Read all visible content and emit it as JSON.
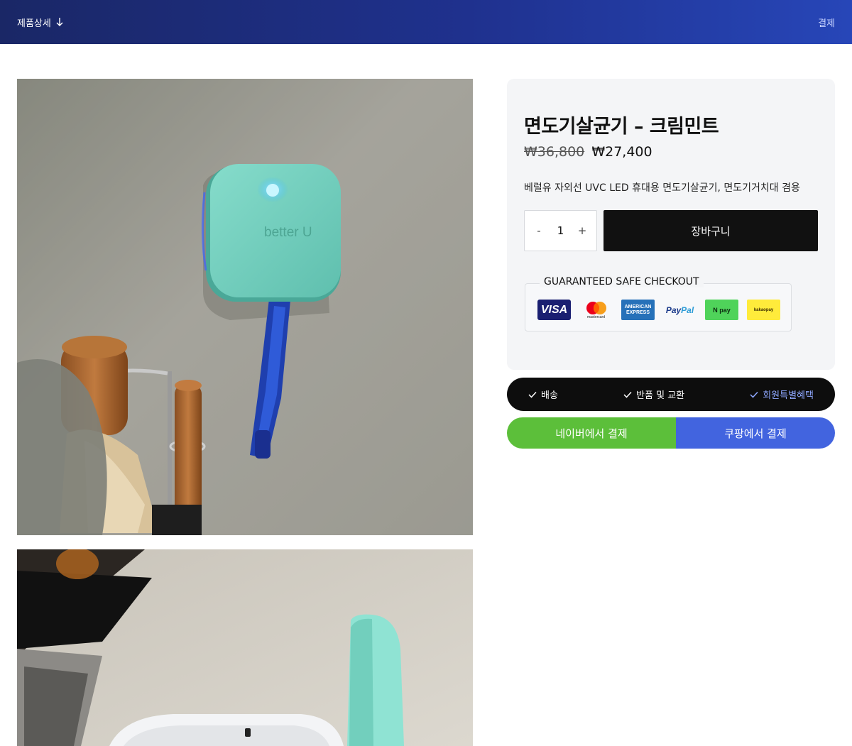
{
  "header": {
    "menu_label": "제품상세",
    "checkout_link": "결제"
  },
  "product": {
    "title": "면도기살균기 – 크림민트",
    "price_old": "₩36,800",
    "price_new": "₩27,400",
    "description": "베럴유 자외선 UVC LED 휴대용 면도기살균기, 면도기거치대 겸용",
    "quantity": "1",
    "qty_minus": "-",
    "qty_plus": "+",
    "add_to_cart": "장바구니",
    "image_brand_text": "better U"
  },
  "safe_checkout": {
    "label": "GUARANTEED SAFE CHECKOUT",
    "logos": {
      "visa": "VISA",
      "mastercard": "mastercard",
      "amex_line1": "AMERICAN",
      "amex_line2": "EXPRESS",
      "paypal_a": "Pay",
      "paypal_b": "Pal",
      "npay": "N pay",
      "kakaopay": "kakaopay"
    }
  },
  "benefits": [
    {
      "label": "배송"
    },
    {
      "label": "반품 및 교환"
    },
    {
      "label": "회원특별혜택"
    }
  ],
  "payment_buttons": {
    "naver": "네이버에서 결제",
    "coupang": "쿠팡에서 결제"
  },
  "colors": {
    "header_start": "#1a2766",
    "header_end": "#2746b8",
    "naver": "#5cbf3a",
    "coupang": "#4264df",
    "accent_link": "#8fa8ff"
  }
}
